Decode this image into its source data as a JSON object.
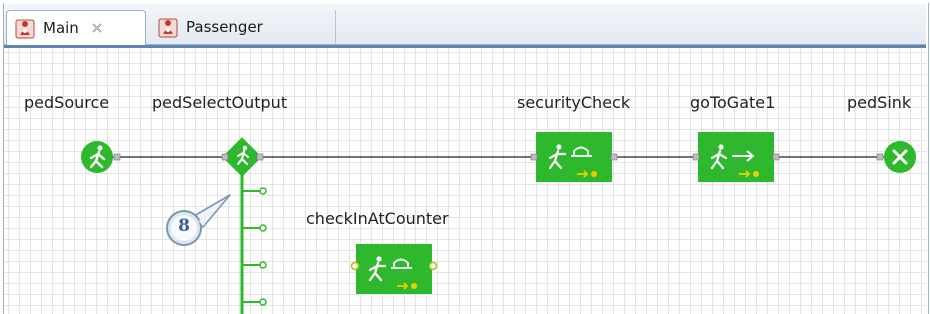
{
  "tabs": [
    {
      "label": "Main",
      "icon": "agent-icon",
      "active": true,
      "closable": true
    },
    {
      "label": "Passenger",
      "icon": "agent-icon",
      "active": false
    }
  ],
  "blocks": {
    "pedSource": "pedSource",
    "pedSelectOutput": "pedSelectOutput",
    "securityCheck": "securityCheck",
    "goToGate1": "goToGate1",
    "pedSink": "pedSink",
    "checkInAtCounter": "checkInAtCounter"
  },
  "callout": {
    "number": "8"
  },
  "colors": {
    "block_green": "#2eb82e",
    "icon_red": "#c0392b",
    "tab_border": "#9db1cb",
    "callout_blue": "#7b95b3"
  }
}
